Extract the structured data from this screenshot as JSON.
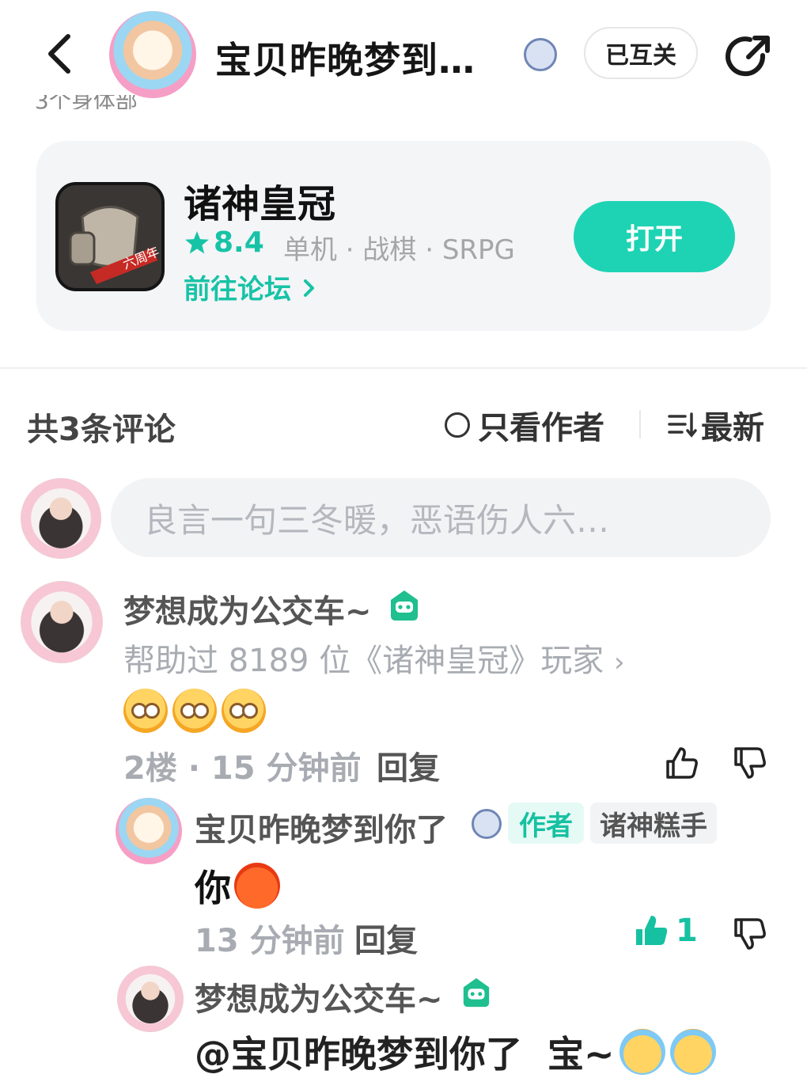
{
  "header": {
    "title": "宝贝昨晚梦到…",
    "follow_label": "已互关"
  },
  "cutoff_text": "3个身体部",
  "game": {
    "name": "诸神皇冠",
    "rating": "8.4",
    "tags": "单机 · 战棋 · SRPG",
    "forum_link": "前往论坛",
    "open_label": "打开",
    "icon_ribbon": "六周年"
  },
  "comments_header": {
    "count_label": "共3条评论",
    "author_only_label": "只看作者",
    "sort_label": "最新"
  },
  "comment_input": {
    "placeholder": "良言一句三冬暖，恶语伤人六…"
  },
  "comments": [
    {
      "user": "梦想成为公交车~",
      "help_text": "帮助过 8189 位《诸神皇冠》玩家",
      "floor_time": "2楼 · 15 分钟前",
      "reply_label": "回复",
      "replies": [
        {
          "user": "宝贝昨晚梦到你了",
          "author_badge": "作者",
          "level_badge": "诸神糕手",
          "text": "你",
          "time": "13 分钟前",
          "reply_label": "回复",
          "likes": "1"
        },
        {
          "user": "梦想成为公交车~",
          "text": "@宝贝昨晚梦到你了  宝~"
        }
      ]
    }
  ],
  "colors": {
    "accent": "#1ED3B4",
    "accent_text": "#16C1A1",
    "muted": "#A8ACB2"
  }
}
